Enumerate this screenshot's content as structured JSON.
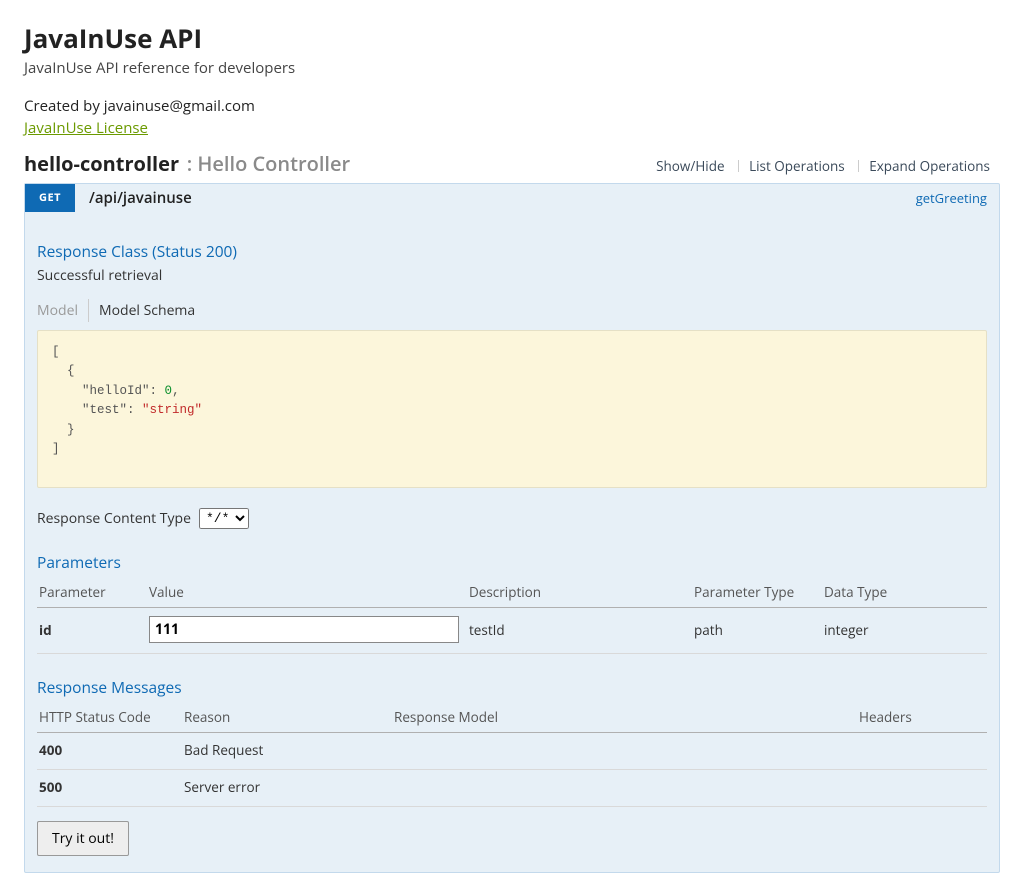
{
  "header": {
    "title": "JavaInUse API",
    "subtitle": "JavaInUse API reference for developers",
    "created_by": "Created by javainuse@gmail.com",
    "license_label": "JavaInUse License"
  },
  "controller": {
    "name": "hello-controller",
    "description": ": Hello Controller",
    "actions": {
      "show_hide": "Show/Hide",
      "list_ops": "List Operations",
      "expand_ops": "Expand Operations"
    }
  },
  "operation": {
    "method": "GET",
    "path": "/api/javainuse",
    "op_id": "getGreeting",
    "response_class": {
      "title": "Response Class (Status 200)",
      "description": "Successful retrieval",
      "tabs": {
        "model": "Model",
        "model_schema": "Model Schema"
      },
      "schema_json": "[\n  {\n    \"helloId\": 0,\n    \"test\": \"string\"\n  }\n]",
      "schema_props": [
        {
          "key": "helloId",
          "value": "0",
          "type": "number"
        },
        {
          "key": "test",
          "value": "\"string\"",
          "type": "string"
        }
      ]
    },
    "content_type": {
      "label": "Response Content Type",
      "selected": "*/*",
      "options": [
        "*/*"
      ]
    },
    "parameters": {
      "title": "Parameters",
      "columns": {
        "parameter": "Parameter",
        "value": "Value",
        "description": "Description",
        "param_type": "Parameter Type",
        "data_type": "Data Type"
      },
      "rows": [
        {
          "name": "id",
          "value": "111",
          "description": "testId",
          "param_type": "path",
          "data_type": "integer"
        }
      ]
    },
    "responses": {
      "title": "Response Messages",
      "columns": {
        "status": "HTTP Status Code",
        "reason": "Reason",
        "model": "Response Model",
        "headers": "Headers"
      },
      "rows": [
        {
          "status": "400",
          "reason": "Bad Request",
          "model": "",
          "headers": ""
        },
        {
          "status": "500",
          "reason": "Server error",
          "model": "",
          "headers": ""
        }
      ]
    },
    "try_button": "Try it out!"
  }
}
